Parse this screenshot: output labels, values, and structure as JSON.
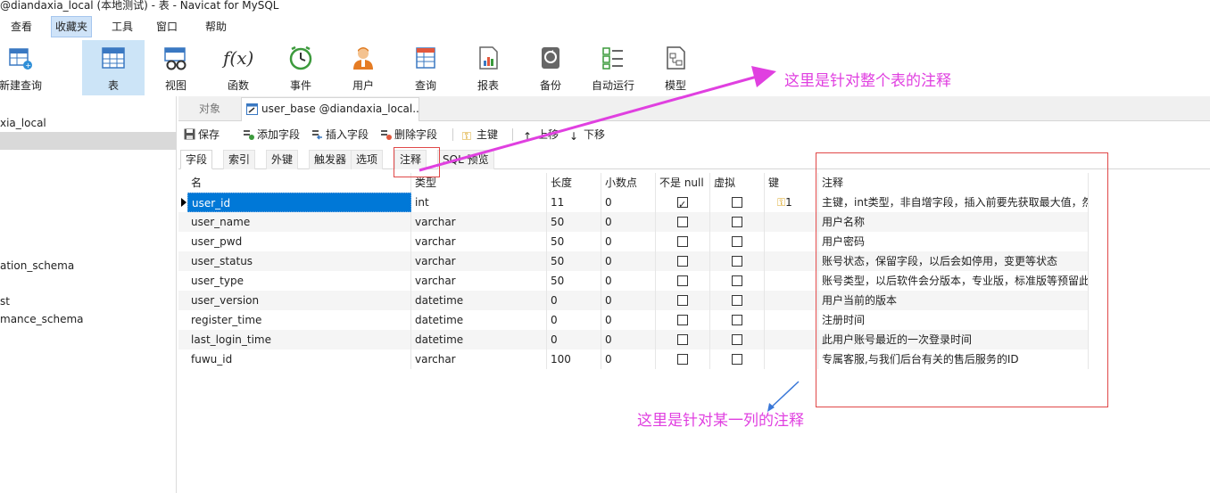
{
  "window": {
    "title": "@diandaxia_local (本地测试) - 表 - Navicat for MySQL"
  },
  "menu": {
    "items": [
      {
        "label": "查看"
      },
      {
        "label": "收藏夹"
      },
      {
        "label": "工具"
      },
      {
        "label": "窗口"
      },
      {
        "label": "帮助"
      }
    ]
  },
  "toolbar": {
    "items": [
      {
        "label": "新建查询",
        "icon": "new-query-icon"
      },
      {
        "label": "表",
        "icon": "table-icon"
      },
      {
        "label": "视图",
        "icon": "view-icon"
      },
      {
        "label": "函数",
        "icon": "function-icon"
      },
      {
        "label": "事件",
        "icon": "event-clock-icon"
      },
      {
        "label": "用户",
        "icon": "user-icon"
      },
      {
        "label": "查询",
        "icon": "query-icon"
      },
      {
        "label": "报表",
        "icon": "report-icon"
      },
      {
        "label": "备份",
        "icon": "backup-icon"
      },
      {
        "label": "自动运行",
        "icon": "auto-run-icon"
      },
      {
        "label": "模型",
        "icon": "model-icon"
      }
    ],
    "function_glyph": "f(x)"
  },
  "tree": {
    "items": [
      {
        "label": "xia_local"
      },
      {
        "label": "ation_schema"
      },
      {
        "label": "st"
      },
      {
        "label": "mance_schema"
      }
    ]
  },
  "tabs": {
    "objects": "对象",
    "document": "user_base @diandaxia_local..."
  },
  "actions": {
    "save": "保存",
    "add_field": "添加字段",
    "insert_field": "插入字段",
    "delete_field": "删除字段",
    "primary_key": "主键",
    "move_up": "上移",
    "move_down": "下移"
  },
  "subtabs": {
    "items": [
      "字段",
      "索引",
      "外键",
      "触发器",
      "选项",
      "注释",
      "SQL 预览"
    ]
  },
  "grid": {
    "headers": {
      "name": "名",
      "type": "类型",
      "length": "长度",
      "decimals": "小数点",
      "not_null": "不是 null",
      "virtual": "虚拟",
      "key": "键",
      "comment": "注释"
    },
    "key_value": "1",
    "rows": [
      {
        "name": "user_id",
        "type": "int",
        "length": "11",
        "decimals": "0",
        "not_null": true,
        "virtual": false,
        "comment": "主键，int类型，非自增字段，插入前要先获取最大值，然"
      },
      {
        "name": "user_name",
        "type": "varchar",
        "length": "50",
        "decimals": "0",
        "not_null": false,
        "virtual": false,
        "comment": "用户名称"
      },
      {
        "name": "user_pwd",
        "type": "varchar",
        "length": "50",
        "decimals": "0",
        "not_null": false,
        "virtual": false,
        "comment": "用户密码"
      },
      {
        "name": "user_status",
        "type": "varchar",
        "length": "50",
        "decimals": "0",
        "not_null": false,
        "virtual": false,
        "comment": "账号状态，保留字段，以后会如停用，变更等状态"
      },
      {
        "name": "user_type",
        "type": "varchar",
        "length": "50",
        "decimals": "0",
        "not_null": false,
        "virtual": false,
        "comment": "账号类型，以后软件会分版本，专业版，标准版等预留此"
      },
      {
        "name": "user_version",
        "type": "datetime",
        "length": "0",
        "decimals": "0",
        "not_null": false,
        "virtual": false,
        "comment": "用户当前的版本"
      },
      {
        "name": "register_time",
        "type": "datetime",
        "length": "0",
        "decimals": "0",
        "not_null": false,
        "virtual": false,
        "comment": "注册时间"
      },
      {
        "name": "last_login_time",
        "type": "datetime",
        "length": "0",
        "decimals": "0",
        "not_null": false,
        "virtual": false,
        "comment": "此用户账号最近的一次登录时间"
      },
      {
        "name": "fuwu_id",
        "type": "varchar",
        "length": "100",
        "decimals": "0",
        "not_null": false,
        "virtual": false,
        "comment": "专属客服,与我们后台有关的售后服务的ID"
      }
    ]
  },
  "annotations": {
    "table_comment": "这里是针对整个表的注释",
    "column_comment": "这里是针对某一列的注释",
    "color": "#e040e0",
    "box_color": "#e04848"
  },
  "colors": {
    "selection": "#0078d7",
    "toolbar_selected": "#cce4f7",
    "menu_active": "#cfe3f8"
  }
}
